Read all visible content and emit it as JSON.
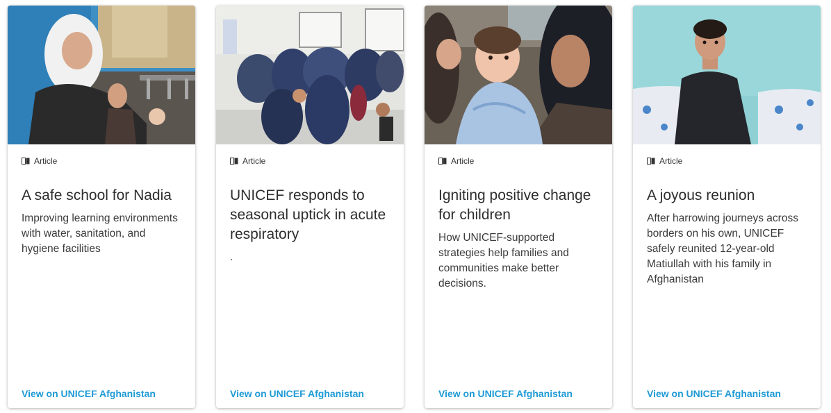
{
  "colors": {
    "link": "#1e9ad6",
    "title": "#2d2d2d",
    "text": "#3a3a3a"
  },
  "cards": [
    {
      "type_label": "Article",
      "type_icon": "book-icon",
      "title": "A safe school for Nadia",
      "description": "Improving learning environments with water, sanitation, and hygiene facilities",
      "link_label": "View on UNICEF Afghanistan",
      "image": "girl-washing-hands-photo"
    },
    {
      "type_label": "Article",
      "type_icon": "book-icon",
      "title": "UNICEF responds to seasonal uptick in acute respiratory",
      "description": ".",
      "link_label": "View on UNICEF Afghanistan",
      "image": "clinic-waiting-room-photo"
    },
    {
      "type_label": "Article",
      "type_icon": "book-icon",
      "title": "Igniting positive change for children",
      "description": "How UNICEF-supported strategies help families and communities make better decisions.",
      "link_label": "View on UNICEF Afghanistan",
      "image": "mother-holding-baby-photo"
    },
    {
      "type_label": "Article",
      "type_icon": "book-icon",
      "title": "A joyous reunion",
      "description": "After harrowing journeys across borders on his own, UNICEF safely reunited 12-year-old Matiullah with his family in Afghanistan",
      "link_label": "View on UNICEF Afghanistan",
      "image": "boy-sitting-on-bed-photo"
    }
  ]
}
